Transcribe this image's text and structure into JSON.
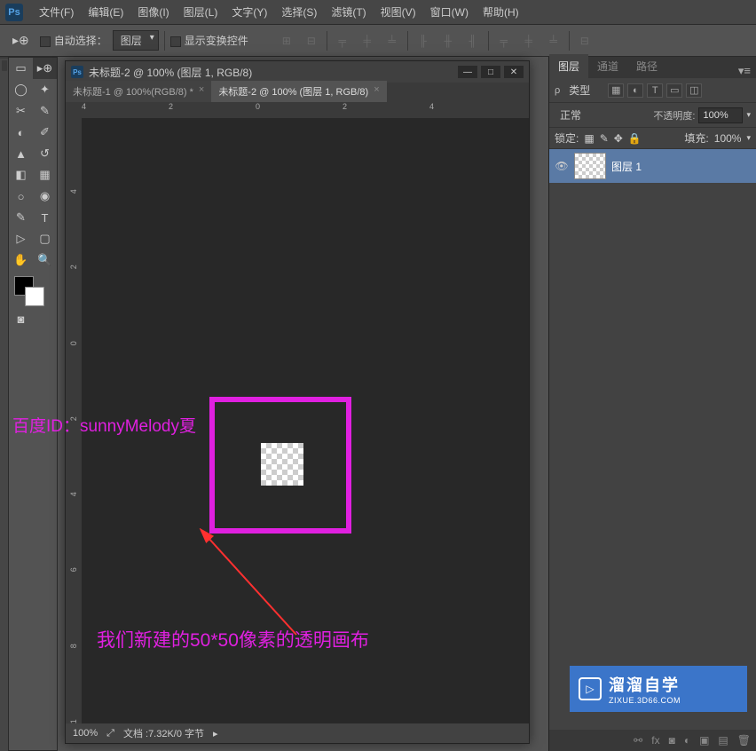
{
  "menu": {
    "file": "文件(F)",
    "edit": "编辑(E)",
    "image": "图像(I)",
    "layer": "图层(L)",
    "type": "文字(Y)",
    "select": "选择(S)",
    "filter": "滤镜(T)",
    "view": "视图(V)",
    "window": "窗口(W)",
    "help": "帮助(H)"
  },
  "options": {
    "auto_select": "自动选择：",
    "target": "图层",
    "show_transform": "显示变换控件"
  },
  "doc": {
    "title": "未标题-2 @ 100% (图层 1, RGB/8)",
    "tab1": "未标题-1 @ 100%(RGB/8) *",
    "tab2": "未标题-2 @ 100% (图层 1, RGB/8)",
    "close": "×",
    "zoom": "100%",
    "status": "文档 :7.32K/0 字节"
  },
  "ruler_h": [
    "4",
    "2",
    "0",
    "2",
    "4"
  ],
  "ruler_v": [
    "4",
    "2",
    "0",
    "2",
    "4",
    "6",
    "8",
    "1"
  ],
  "ann": {
    "id_text": "百度ID：sunnyMelody夏",
    "desc": "我们新建的50*50像素的透明画布"
  },
  "panels": {
    "tabs": {
      "layers": "图层",
      "channels": "通道",
      "paths": "路径"
    },
    "kind_label": "类型",
    "blend_mode": "正常",
    "opacity_label": "不透明度:",
    "opacity_value": "100%",
    "lock_label": "锁定:",
    "fill_label": "填充:",
    "fill_value": "100%",
    "layer1_name": "图层 1"
  },
  "brand": {
    "cn": "溜溜自学",
    "en": "ZIXUE.3D66.COM"
  }
}
